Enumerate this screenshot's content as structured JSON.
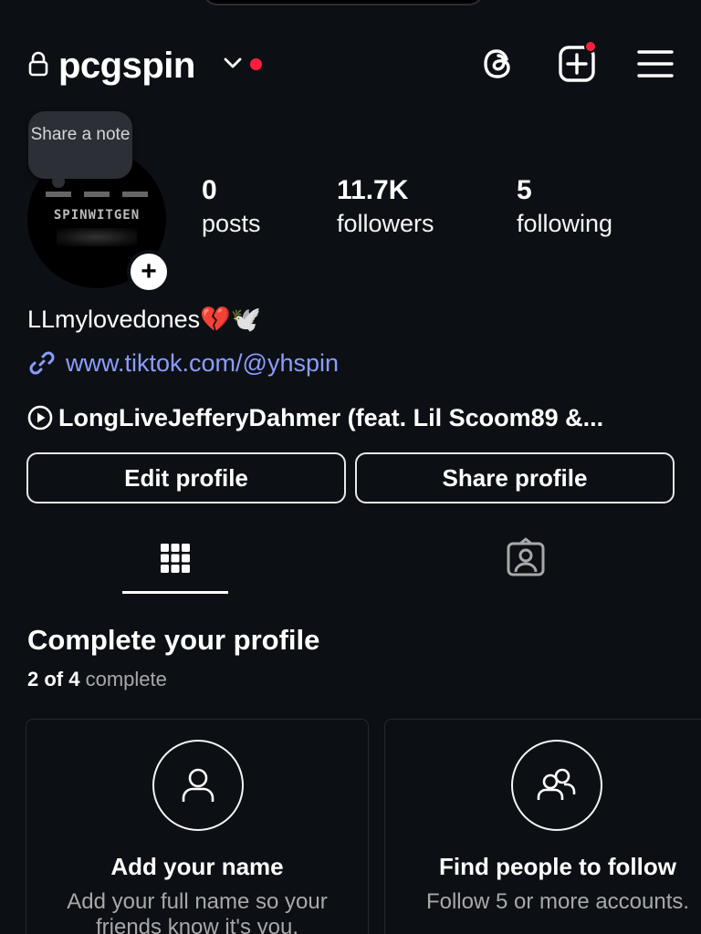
{
  "header": {
    "username": "pcgspin",
    "icons": [
      "lock-icon",
      "chevron-down-icon",
      "threads-icon",
      "create-plus-icon",
      "hamburger-menu-icon"
    ]
  },
  "note": {
    "text": "Share a note"
  },
  "avatar": {
    "label": "SPINWITGEN"
  },
  "stats": {
    "posts": {
      "value": "0",
      "label": "posts"
    },
    "followers": {
      "value": "11.7K",
      "label": "followers"
    },
    "following": {
      "value": "5",
      "label": "following"
    }
  },
  "bio": {
    "name": "LLmylovedones💔🕊️",
    "link": "www.tiktok.com/@yhspin",
    "music": "LongLiveJefferyDahmer (feat. Lil Scoom89 &..."
  },
  "buttons": {
    "edit": "Edit profile",
    "share": "Share profile"
  },
  "tabs": [
    "grid-icon",
    "tagged-icon"
  ],
  "complete_profile": {
    "title": "Complete your profile",
    "count": "2 of 4",
    "suffix": "complete",
    "cards": [
      {
        "icon": "person-icon",
        "title": "Add your name",
        "desc_line1": "Add your full name so your",
        "desc_line2": "friends know it's you."
      },
      {
        "icon": "people-icon",
        "title": "Find people to follow",
        "desc_line1": "Follow 5 or more accounts."
      }
    ]
  },
  "colors": {
    "background": "#0c1014",
    "link": "#8c9cff",
    "notification": "#ff1f3d",
    "muted_text": "#a8a8a8"
  }
}
